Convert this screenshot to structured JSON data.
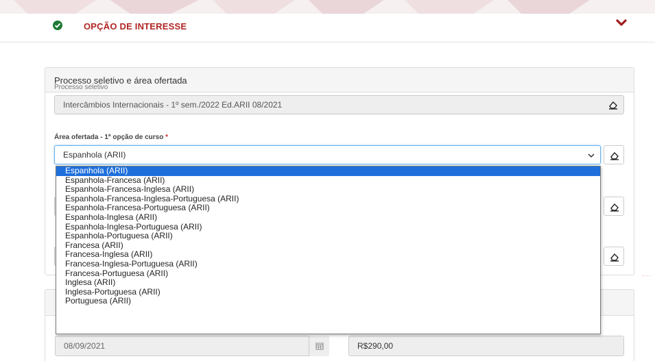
{
  "section": {
    "title": "OPÇÃO DE INTERESSE"
  },
  "panel": {
    "heading": "Processo seletivo e área ofertada"
  },
  "processo": {
    "label": "Processo seletivo",
    "value": "Intercâmbios Internacionais - 1º sem./2022 Ed.ARII 08/2021"
  },
  "area": {
    "label": "Área ofertada - 1ª opção de curso",
    "required_mark": "*",
    "selected": "Espanhola (ARII)",
    "options": [
      "Espanhola (ARII)",
      "Espanhola-Francesa (ARII)",
      "Espanhola-Francesa-Inglesa (ARII)",
      "Espanhola-Francesa-Inglesa-Portuguesa (ARII)",
      "Espanhola-Francesa-Portuguesa (ARII)",
      "Espanhola-Inglesa (ARII)",
      "Espanhola-Inglesa-Portuguesa (ARII)",
      "Espanhola-Portuguesa (ARII)",
      "Francesa (ARII)",
      "Francesa-Inglesa (ARII)",
      "Francesa-Inglesa-Portuguesa (ARII)",
      "Francesa-Portuguesa (ARII)",
      "Inglesa (ARII)",
      "Inglesa-Portuguesa (ARII)",
      "Portuguesa (ARII)"
    ]
  },
  "payment": {
    "date": "08/09/2021",
    "price": "R$290,00"
  },
  "icons": {
    "check": "check-circle-icon",
    "chevron": "chevron-down-icon",
    "eraser": "eraser-icon",
    "calendar": "calendar-icon"
  },
  "colors": {
    "accent_red": "#b12424",
    "check_green": "#1e7b34",
    "selected_option": "#1e6fdb"
  }
}
